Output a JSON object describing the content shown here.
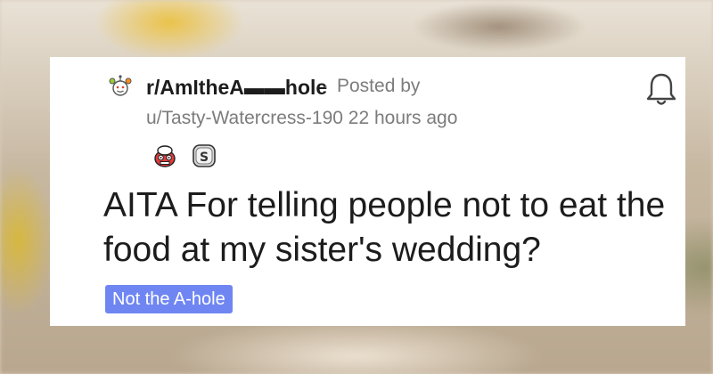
{
  "post": {
    "subreddit": "r/AmItheA▬▬hole",
    "separator": "·",
    "posted_by_label": "Posted by",
    "username": "u/Tasty-Watercress-190",
    "time_ago": "22 hours ago",
    "title": "AITA For telling people not to eat the food at my sister's wedding?",
    "flair": "Not the A-hole",
    "awards": [
      "helmet-face-award-icon",
      "silver-s-award-icon"
    ]
  },
  "colors": {
    "flair_bg": "#6f86f2",
    "meta_text": "#7c7c7c",
    "title_text": "#1c1c1c"
  }
}
